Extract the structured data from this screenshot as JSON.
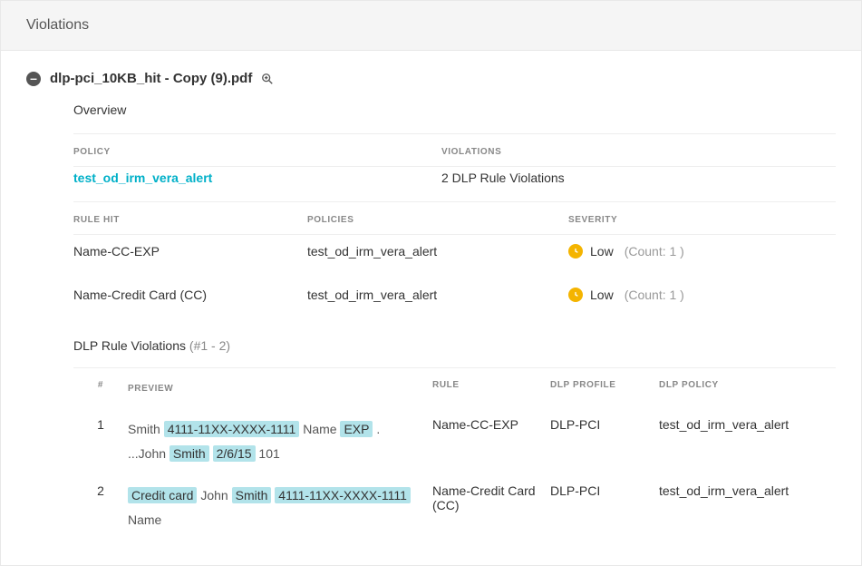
{
  "header": {
    "title": "Violations"
  },
  "file": {
    "name": "dlp-pci_10KB_hit - Copy (9).pdf"
  },
  "overview": {
    "label": "Overview",
    "headers": {
      "policy": "POLICY",
      "violations": "VIOLATIONS"
    },
    "policy_link": "test_od_irm_vera_alert",
    "violations_text": "2 DLP Rule Violations"
  },
  "rules": {
    "headers": {
      "rule_hit": "RULE HIT",
      "policies": "POLICIES",
      "severity": "SEVERITY"
    },
    "rows": [
      {
        "rule_hit": "Name-CC-EXP",
        "policy": "test_od_irm_vera_alert",
        "severity": "Low",
        "count": "(Count: 1 )"
      },
      {
        "rule_hit": "Name-Credit Card (CC)",
        "policy": "test_od_irm_vera_alert",
        "severity": "Low",
        "count": "(Count: 1 )"
      }
    ]
  },
  "dlp": {
    "title": "DLP Rule Violations",
    "range": "(#1 - 2)",
    "headers": {
      "num": "#",
      "preview": "PREVIEW",
      "rule": "RULE",
      "profile": "DLP PROFILE",
      "policy": "DLP POLICY"
    },
    "rows": [
      {
        "num": "1",
        "preview": [
          {
            "t": "Smith ",
            "hl": false
          },
          {
            "t": "4111-11XX-XXXX-1111",
            "hl": true
          },
          {
            "t": "  Name  ",
            "hl": false
          },
          {
            "t": "EXP",
            "hl": true
          },
          {
            "t": " . ...John ",
            "hl": false
          },
          {
            "t": "Smith",
            "hl": true
          },
          {
            "t": "     ",
            "hl": false
          },
          {
            "t": "2/6/15",
            "hl": true
          },
          {
            "t": "   101",
            "hl": false
          }
        ],
        "rule": "Name-CC-EXP",
        "profile": "DLP-PCI",
        "policy": "test_od_irm_vera_alert"
      },
      {
        "num": "2",
        "preview": [
          {
            "t": " ",
            "hl": false
          },
          {
            "t": "Credit card",
            "hl": true
          },
          {
            "t": "  John  ",
            "hl": false
          },
          {
            "t": "Smith",
            "hl": true
          },
          {
            "t": "     ",
            "hl": false
          },
          {
            "t": "4111-11XX-XXXX-1111",
            "hl": true
          },
          {
            "t": "   Name",
            "hl": false
          }
        ],
        "rule": "Name-Credit Card (CC)",
        "profile": "DLP-PCI",
        "policy": "test_od_irm_vera_alert"
      }
    ]
  }
}
